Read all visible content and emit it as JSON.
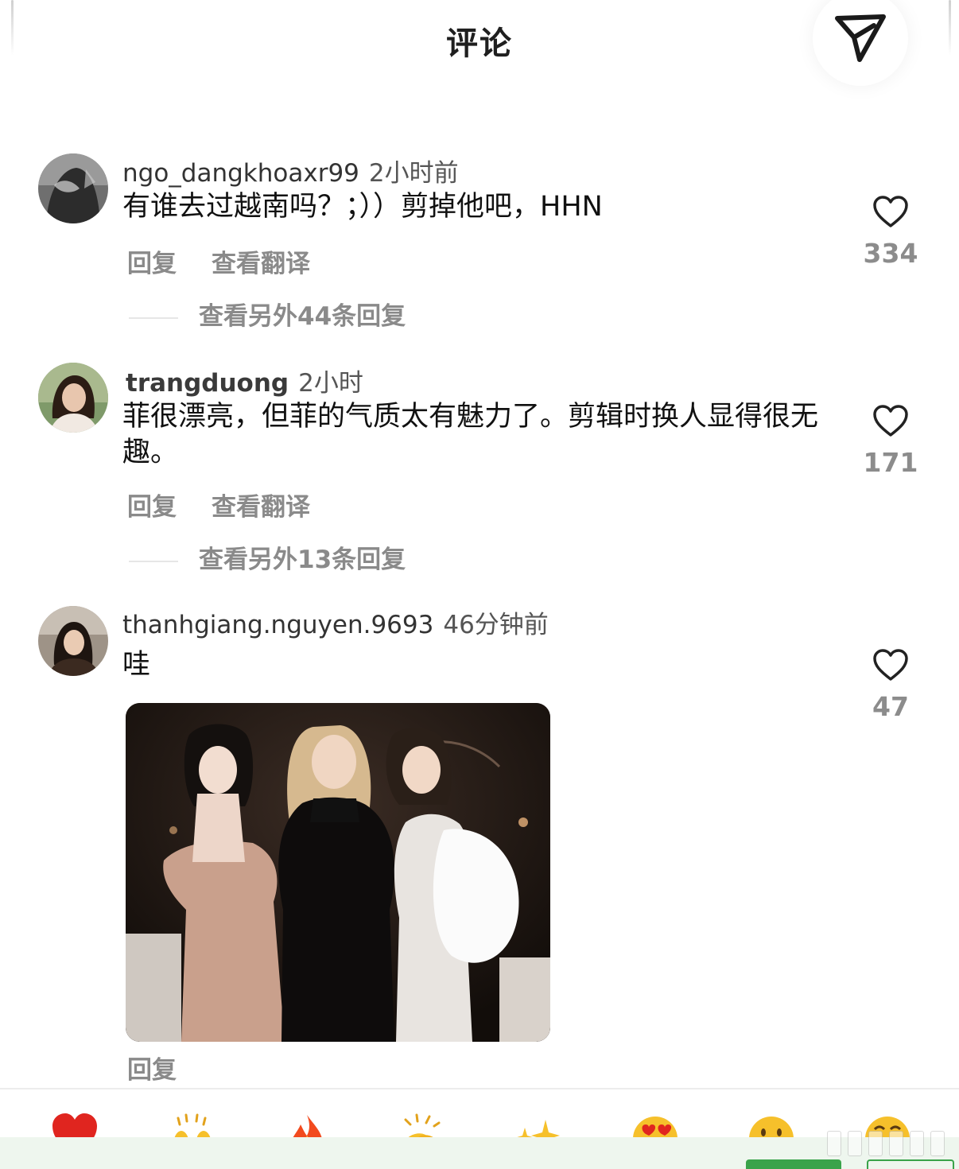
{
  "header": {
    "title": "评论"
  },
  "comments": [
    {
      "username": "ngo_dangkhoaxr99",
      "time": "2小时前",
      "text": "有谁去过越南吗？；））剪掉他吧，HHN",
      "reply_label": "回复",
      "translate_label": "查看翻译",
      "more_replies": "查看另外44条回复",
      "likes": "334"
    },
    {
      "username": "trangduong",
      "time": "2小时",
      "text": "菲很漂亮，但菲的气质太有魅力了。剪辑时换人显得很无趣。",
      "reply_label": "回复",
      "translate_label": "查看翻译",
      "more_replies": "查看另外13条回复",
      "likes": "171"
    },
    {
      "username": "thanhgiang.nguyen.9693",
      "time": "46分钟前",
      "text": "哇",
      "reply_label": "回复",
      "likes": "47"
    }
  ],
  "emoji_bar": [
    "heart-emoji",
    "raised-hands-emoji",
    "fire-emoji",
    "clapping-hands-emoji",
    "sparkles-emoji",
    "heart-eyes-emoji",
    "smile-emoji",
    "crying-laugh-emoji"
  ],
  "colors": {
    "accent_green": "#3aa34a",
    "heart_outline": "#222222",
    "muted_text": "#8a8a8a"
  }
}
